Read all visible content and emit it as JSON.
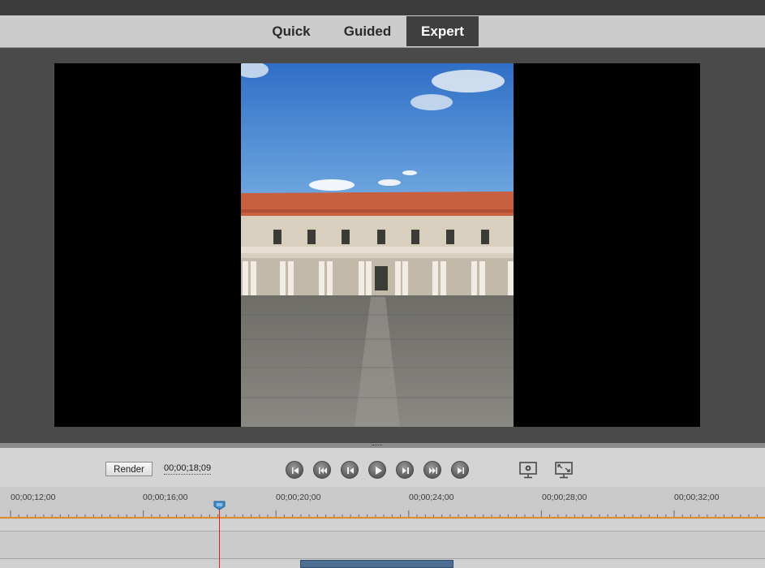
{
  "mode_tabs": [
    {
      "label": "Quick",
      "active": false
    },
    {
      "label": "Guided",
      "active": false
    },
    {
      "label": "Expert",
      "active": true
    }
  ],
  "controls": {
    "render_label": "Render",
    "current_timecode": "00;00;18;09"
  },
  "playback_buttons": [
    "go-to-beginning-icon",
    "go-to-previous-clip-icon",
    "step-back-icon",
    "play-icon",
    "step-forward-icon",
    "go-to-next-clip-icon",
    "go-to-end-icon"
  ],
  "monitor_buttons": [
    "monitor-settings-icon",
    "fullscreen-monitor-icon"
  ],
  "timeline": {
    "ruler_labels": [
      "00;00;12;00",
      "00;00;16;00",
      "00;00;20;00",
      "00;00;24;00",
      "00;00;28;00",
      "00;00;32;00"
    ]
  },
  "colors": {
    "active_tab": "#3f3f3f",
    "playhead": "#e0201e",
    "clip": "#4e6f93",
    "ruler_accent": "#e08a2c"
  }
}
